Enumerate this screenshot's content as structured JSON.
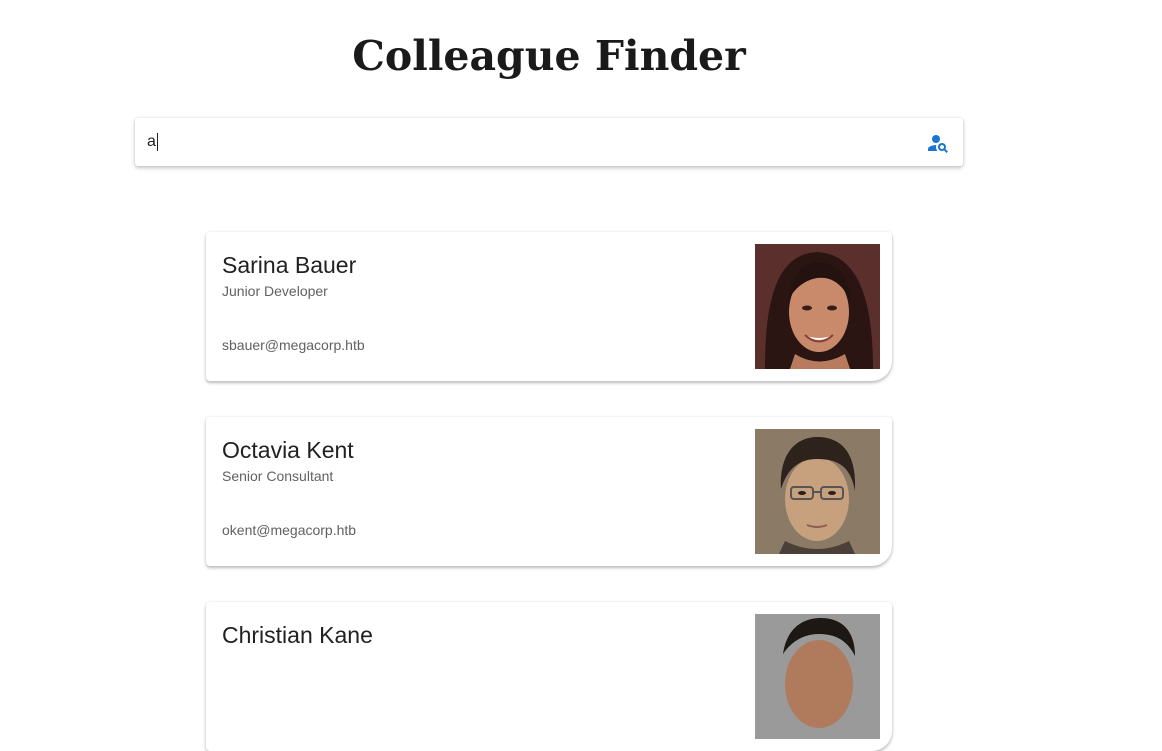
{
  "header": {
    "title": "Colleague Finder"
  },
  "search": {
    "value": "a",
    "icon": "person-search-icon",
    "icon_color": "#1976d2"
  },
  "colleagues": [
    {
      "name": "Sarina Bauer",
      "role": "Junior Developer",
      "email": "sbauer@megacorp.htb",
      "photo": "portrait-photo"
    },
    {
      "name": "Octavia Kent",
      "role": "Senior Consultant",
      "email": "okent@megacorp.htb",
      "photo": "portrait-photo"
    },
    {
      "name": "Christian Kane",
      "role": "",
      "email": "",
      "photo": "portrait-photo"
    }
  ]
}
